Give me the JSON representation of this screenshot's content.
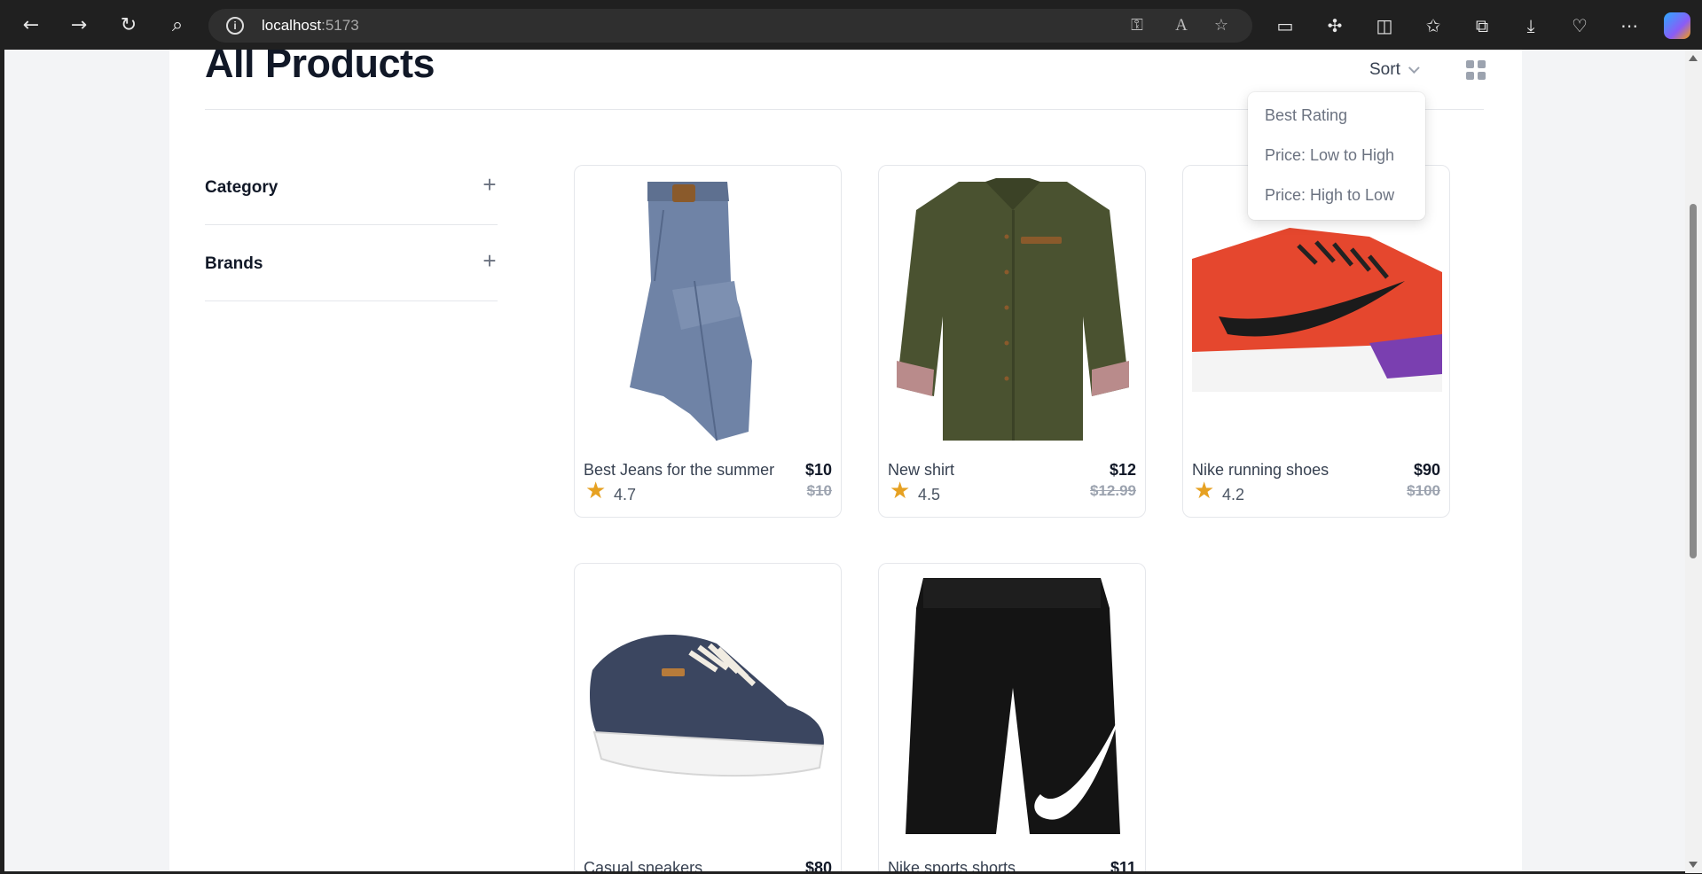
{
  "browser": {
    "url_host": "localhost",
    "url_port": ":5173",
    "back_icon": "←",
    "forward_icon": "→",
    "reload_icon": "↻",
    "search_icon": "⌕",
    "info_icon": "i"
  },
  "page": {
    "title": "All Products",
    "sort_label": "Sort",
    "sort_options": [
      "Best Rating",
      "Price: Low to High",
      "Price: High to Low"
    ]
  },
  "filters": [
    {
      "label": "Category",
      "icon": "+"
    },
    {
      "label": "Brands",
      "icon": "+"
    }
  ],
  "products": [
    {
      "name": "Best Jeans for the summer",
      "price": "$10",
      "old_price": "$10",
      "rating": "4.7",
      "star": "★"
    },
    {
      "name": "New shirt",
      "price": "$12",
      "old_price": "$12.99",
      "rating": "4.5",
      "star": "★"
    },
    {
      "name": "Nike running shoes",
      "price": "$90",
      "old_price": "$100",
      "rating": "4.2",
      "star": "★"
    },
    {
      "name": "Casual sneakers",
      "price": "$80",
      "old_price": "",
      "rating": "",
      "star": ""
    },
    {
      "name": "Nike sports shorts",
      "price": "$11",
      "old_price": "",
      "rating": "",
      "star": ""
    }
  ],
  "colors": {
    "title": "#111827",
    "star": "#e6a122",
    "browser_bg": "#202020"
  }
}
